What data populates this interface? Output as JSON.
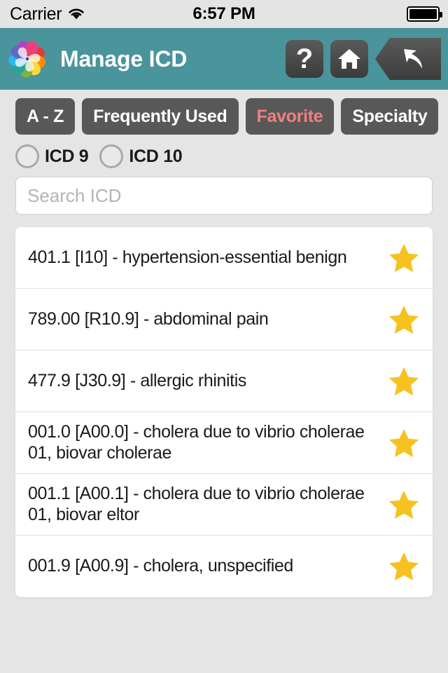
{
  "status_bar": {
    "carrier": "Carrier",
    "wifi_icon": "wifi-icon",
    "time": "6:57 PM",
    "battery_icon": "battery-full-icon"
  },
  "header": {
    "logo_icon": "pinwheel-logo-icon",
    "title": "Manage ICD",
    "help_label": "?",
    "home_icon": "home-icon",
    "back_icon": "back-arrow-icon",
    "background_color": "#4a949c"
  },
  "tabs": [
    {
      "label": "A - Z",
      "active": false
    },
    {
      "label": "Frequently Used",
      "active": false
    },
    {
      "label": "Favorite",
      "active": true
    },
    {
      "label": "Specialty",
      "active": false
    }
  ],
  "tab_colors": {
    "inactive_text": "#ffffff",
    "active_text": "#f08080",
    "background": "#585858"
  },
  "radios": [
    {
      "label": "ICD 9",
      "selected": false
    },
    {
      "label": "ICD 10",
      "selected": false
    }
  ],
  "search": {
    "placeholder": "Search ICD",
    "value": ""
  },
  "list": {
    "star_icon": "star-filled-icon",
    "star_color": "#f5c220",
    "rows": [
      {
        "text": "401.1 [I10] - hypertension-essential benign",
        "favorited": true
      },
      {
        "text": "789.00 [R10.9] - abdominal pain",
        "favorited": true
      },
      {
        "text": "477.9 [J30.9] - allergic rhinitis",
        "favorited": true
      },
      {
        "text": "001.0 [A00.0] - cholera due to vibrio cholerae 01, biovar cholerae",
        "favorited": true
      },
      {
        "text": "001.1 [A00.1] - cholera due to vibrio cholerae 01, biovar eltor",
        "favorited": true
      },
      {
        "text": "001.9 [A00.9] - cholera, unspecified",
        "favorited": true
      }
    ]
  }
}
